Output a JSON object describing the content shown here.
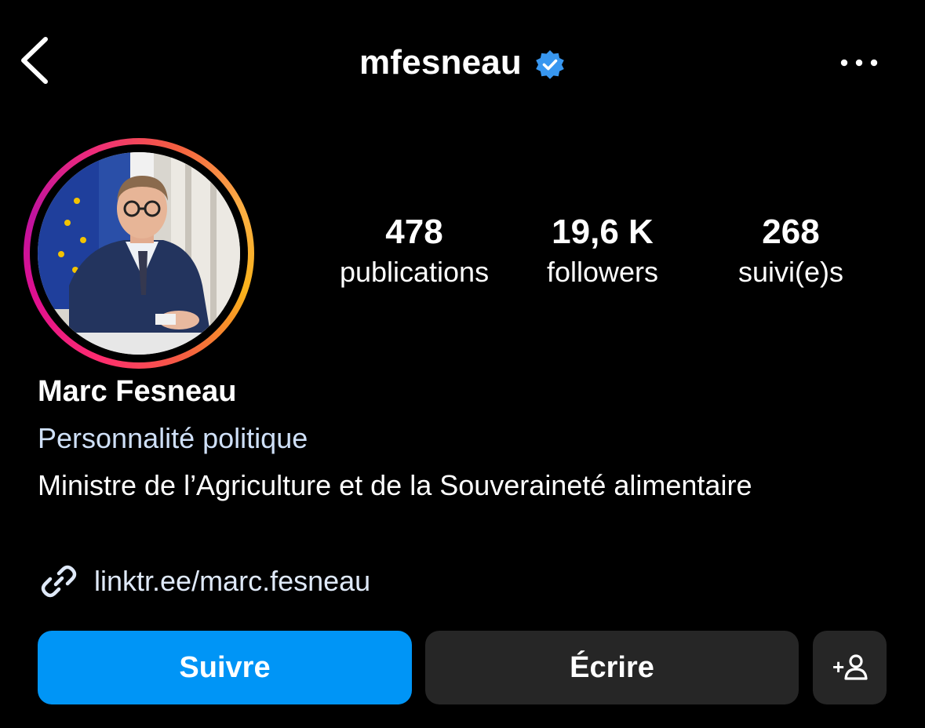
{
  "header": {
    "username": "mfesneau",
    "back_icon": "chevron-left-icon",
    "verified_icon": "verified-badge-icon",
    "more_icon": "more-horizontal-icon"
  },
  "profile": {
    "avatar_alt": "profile photo",
    "display_name": "Marc Fesneau",
    "category": "Personnalité politique",
    "bio": "Ministre de l’Agriculture et de la Souveraineté alimentaire",
    "link": "linktr.ee/marc.fesneau",
    "link_icon": "link-icon"
  },
  "stats": [
    {
      "value": "478",
      "label": "publications"
    },
    {
      "value": "19,6 K",
      "label": "followers"
    },
    {
      "value": "268",
      "label": "suivi(e)s"
    }
  ],
  "actions": {
    "follow_label": "Suivre",
    "message_label": "Écrire",
    "suggest_icon": "add-person-icon",
    "suggest_text": "+"
  },
  "colors": {
    "background": "#000000",
    "primary_button": "#0095f6",
    "secondary_button": "#262626",
    "verified": "#3897f0"
  }
}
